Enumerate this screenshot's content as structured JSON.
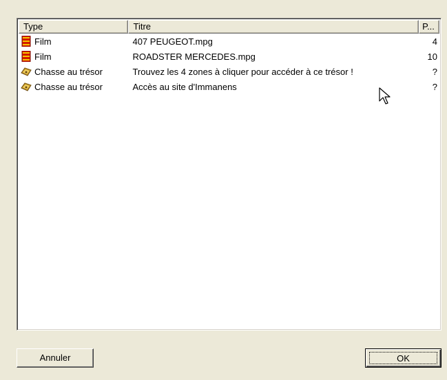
{
  "list": {
    "columns": {
      "type": "Type",
      "title": "Titre",
      "p": "P..."
    },
    "rows": [
      {
        "icon": "film-icon",
        "type": "Film",
        "title": "407 PEUGEOT.mpg",
        "p": "4"
      },
      {
        "icon": "film-icon",
        "type": "Film",
        "title": "ROADSTER MERCEDES.mpg",
        "p": "10"
      },
      {
        "icon": "treasure-icon",
        "type": "Chasse au trésor",
        "title": "Trouvez les 4 zones à cliquer pour accéder à ce trésor !",
        "p": "?"
      },
      {
        "icon": "treasure-icon",
        "type": "Chasse au trésor",
        "title": "Accès au site d'Immanens",
        "p": "?"
      }
    ]
  },
  "buttons": {
    "cancel": "Annuler",
    "ok": "OK"
  },
  "colors": {
    "dialog_bg": "#ece9d8",
    "list_bg": "#ffffff"
  }
}
